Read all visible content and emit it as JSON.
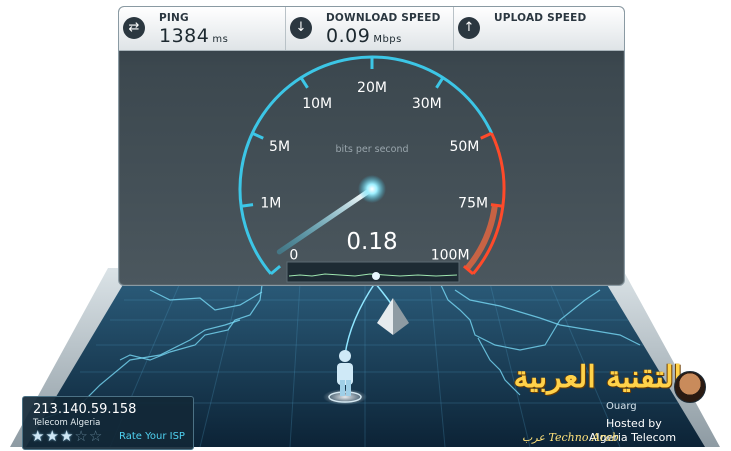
{
  "stats": {
    "ping": {
      "label": "PING",
      "value": "1384",
      "unit": "ms",
      "icon": "ping-arrows-icon"
    },
    "download": {
      "label": "DOWNLOAD SPEED",
      "value": "0.09",
      "unit": "Mbps",
      "icon": "download-arrow-icon"
    },
    "upload": {
      "label": "UPLOAD SPEED",
      "value": "",
      "unit": "",
      "icon": "upload-arrow-icon"
    }
  },
  "gauge": {
    "unit_caption": "bits per second",
    "reading": "0.18",
    "needle_value": 0.18,
    "ticks": [
      "0",
      "1M",
      "5M",
      "10M",
      "20M",
      "30M",
      "50M",
      "75M",
      "100M"
    ],
    "colors": {
      "normal": "#3cc6e6",
      "high": "#ff4a2a"
    }
  },
  "isp": {
    "ip": "213.140.59.158",
    "name": "Telecom Algeria",
    "rating": 3,
    "max_rating": 5,
    "rate_label": "Rate Your ISP"
  },
  "host": {
    "city": "Ouarg",
    "line1": "Hosted by",
    "line2": "Algeria Telecom"
  },
  "watermark": {
    "arabic": "التقنية العربية",
    "sub_arabic": "عرب",
    "sub_latin": "Techno Arab"
  }
}
